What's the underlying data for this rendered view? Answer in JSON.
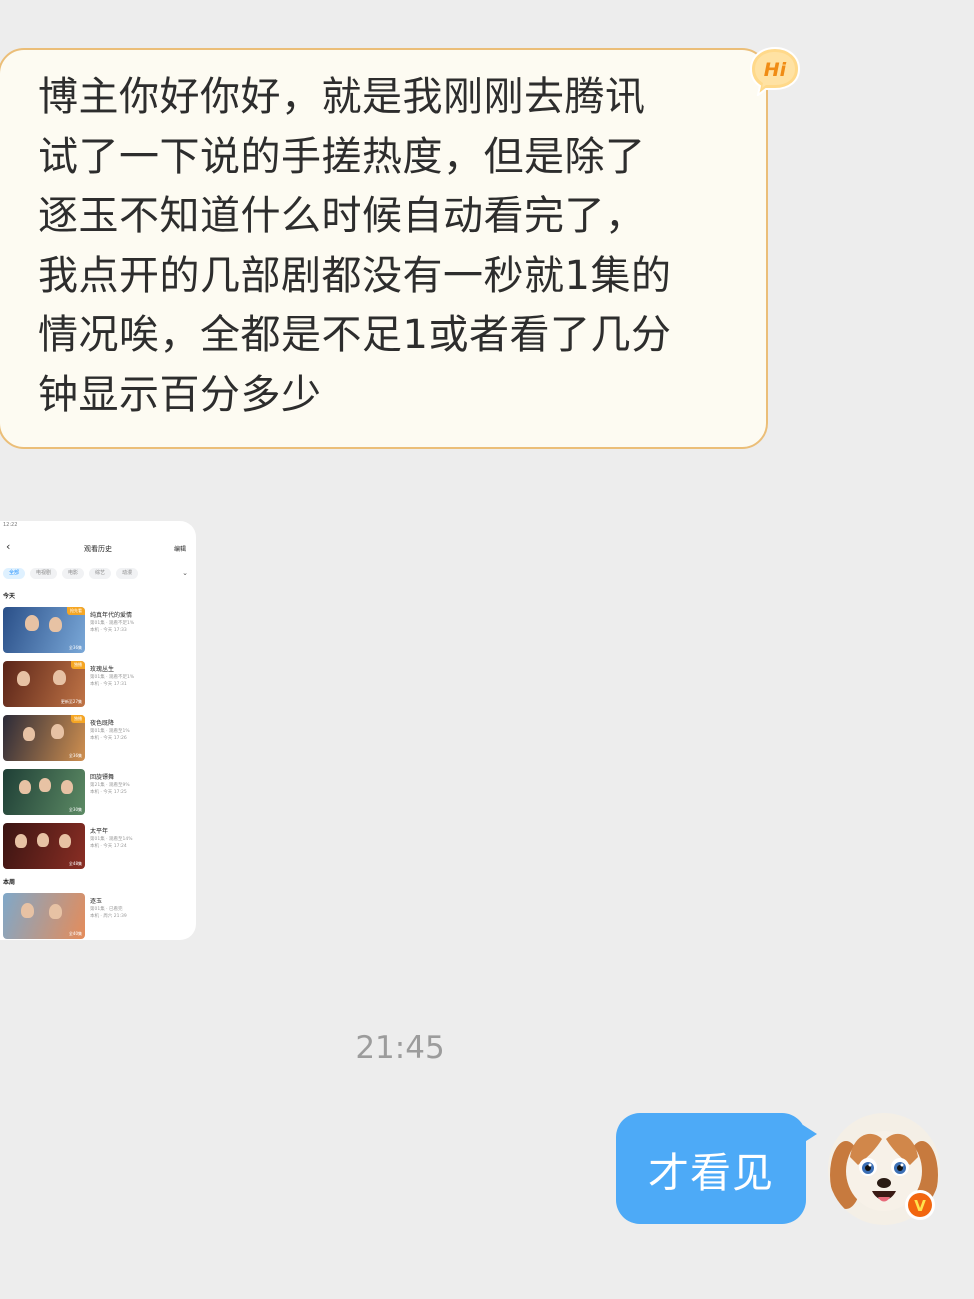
{
  "incoming_message": {
    "text": "博主你好你好，就是我刚刚去腾讯\n试了一下说的手搓热度，但是除了\n逐玉不知道什么时候自动看完了，\n我点开的几部剧都没有一秒就1集的\n情况唉，全都是不足1或者看了几分\n钟显示百分多少",
    "badge": "Hi"
  },
  "attached_screenshot": {
    "status_time": "12:22",
    "header": {
      "back_icon": "‹",
      "title": "观看历史",
      "edit": "编辑"
    },
    "filters": [
      "全部",
      "电视剧",
      "电影",
      "综艺",
      "动漫"
    ],
    "sections": [
      {
        "label": "今天",
        "items": [
          {
            "title": "纯真年代的爱情",
            "tag": "抢先看",
            "ep_badge": "全36集",
            "progress": "第01集 · 观看不足1%",
            "device": "本机 · 今天 17:33",
            "colors": [
              "#2a4f88",
              "#7aa8d8"
            ]
          },
          {
            "title": "玫瑰丛生",
            "tag": "独播",
            "ep_badge": "更新至27集",
            "progress": "第01集 · 观看不足1%",
            "device": "本机 · 今天 17:31",
            "colors": [
              "#5a2418",
              "#c07446"
            ]
          },
          {
            "title": "夜色既降",
            "tag": "独播",
            "ep_badge": "全36集",
            "progress": "第01集 · 观看至1%",
            "device": "本机 · 今天 17:26",
            "colors": [
              "#2b2a38",
              "#d09050"
            ]
          },
          {
            "title": "回旋镖舞",
            "tag": "",
            "ep_badge": "全30集",
            "progress": "第21集 · 观看至9%",
            "device": "本机 · 今天 17:25",
            "colors": [
              "#1f3f36",
              "#5c8a64"
            ]
          },
          {
            "title": "太平年",
            "tag": "",
            "ep_badge": "全48集",
            "progress": "第01集 · 观看至14%",
            "device": "本机 · 今天 17:24",
            "colors": [
              "#3a1412",
              "#8a2e24"
            ]
          }
        ]
      },
      {
        "label": "本周",
        "items": [
          {
            "title": "逐玉",
            "tag": "",
            "ep_badge": "全40集",
            "progress": "第01集 · 已看完",
            "device": "本机 · 周六 21:39",
            "colors": [
              "#7fa8c9",
              "#e58c5a"
            ]
          }
        ]
      }
    ]
  },
  "timestamp": "21:45",
  "outgoing_message": {
    "text": "才看见"
  },
  "avatar": {
    "icon": "dog-avatar-icon",
    "badge": "V",
    "badge_color": "#f2660f"
  },
  "colors": {
    "background": "#ededed",
    "incoming_bubble": "#fdfbf2",
    "incoming_border": "#ebbe78",
    "outgoing_bubble": "#4daaf7"
  }
}
